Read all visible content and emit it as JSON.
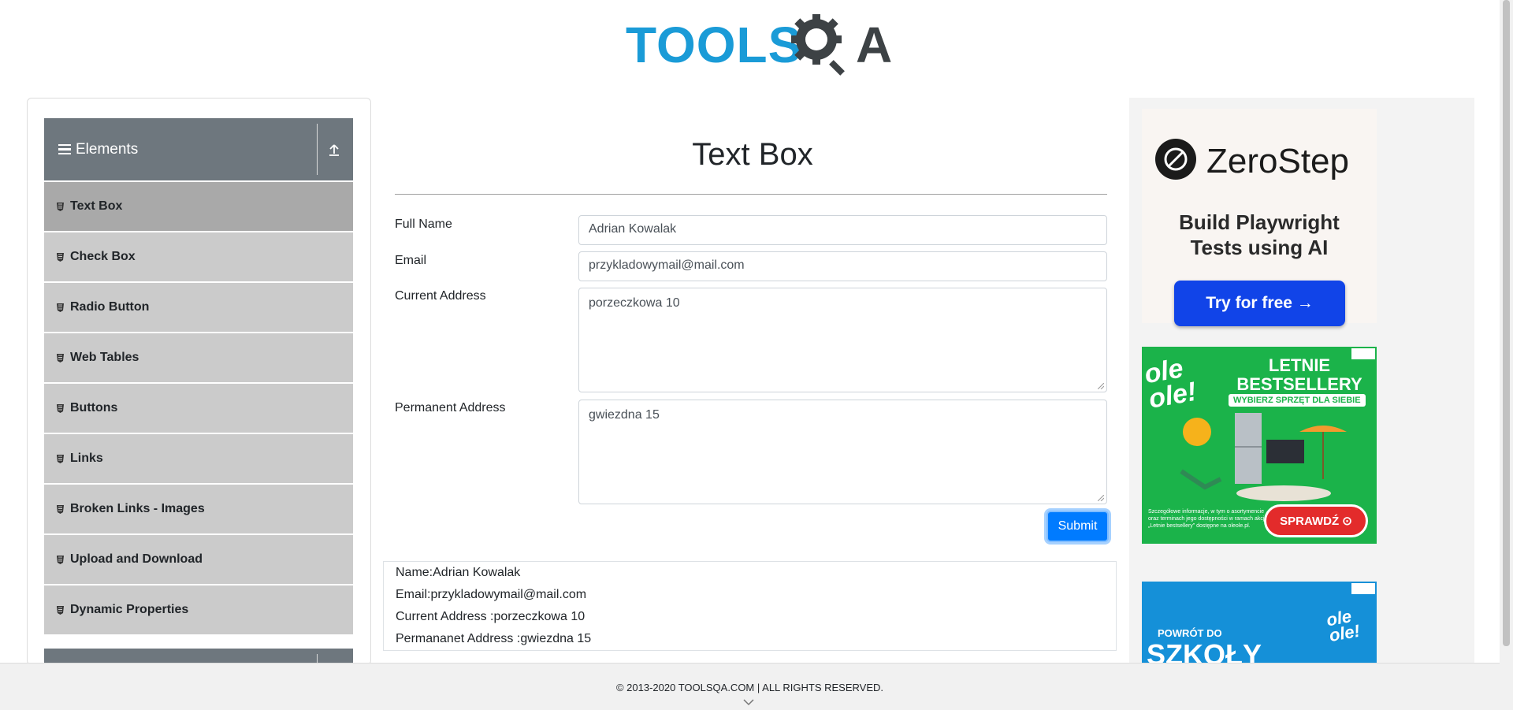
{
  "logo": {
    "part1": "TOOLS",
    "part2": "A"
  },
  "sidebar": {
    "group_title": "Elements",
    "items": [
      {
        "label": "Text Box"
      },
      {
        "label": "Check Box"
      },
      {
        "label": "Radio Button"
      },
      {
        "label": "Web Tables"
      },
      {
        "label": "Buttons"
      },
      {
        "label": "Links"
      },
      {
        "label": "Broken Links - Images"
      },
      {
        "label": "Upload and Download"
      },
      {
        "label": "Dynamic Properties"
      }
    ]
  },
  "main": {
    "title": "Text Box",
    "full_name_label": "Full Name",
    "full_name_value": "Adrian Kowalak",
    "email_label": "Email",
    "email_value": "przykladowymail@mail.com",
    "current_address_label": "Current Address",
    "current_address_value": "porzeczkowa 10",
    "permanent_address_label": "Permanent Address",
    "permanent_address_value": "gwiezdna 15",
    "submit_label": "Submit",
    "output": {
      "name": "Name:Adrian Kowalak",
      "email": "Email:przykladowymail@mail.com",
      "current": "Current Address :porzeczkowa 10",
      "permanent": "Permananet Address :gwiezdna 15"
    }
  },
  "ads": {
    "ad1": {
      "brand": "ZeroStep",
      "tagline_1": "Build Playwright",
      "tagline_2": "Tests using AI",
      "cta": "Try for free →"
    },
    "ad2": {
      "brand_1": "ole",
      "brand_2": "ole!",
      "title_1": "LETNIE",
      "title_2": "BESTSELLERY",
      "subtitle": "WYBIERZ SPRZĘT DLA SIEBIE",
      "fine_print": "Szczegółowe informacje, w tym o asortymencie oraz terminach jego dostępności w ramach akcji „Letnie bestsellery” dostępne na oleole.pl.",
      "cta": "SPRAWDŹ ⊙"
    },
    "ad3": {
      "top": "POWRÓT DO",
      "big": "SZKOŁY",
      "brand_1": "ole",
      "brand_2": "ole!"
    }
  },
  "footer": {
    "text": "© 2013-2020 TOOLSQA.COM | ALL RIGHTS RESERVED."
  },
  "colors": {
    "accent": "#007bff",
    "sidebar_header": "#6e777e",
    "sidebar_item": "#cbcbcb",
    "logo_blue": "#1a9bd7"
  }
}
